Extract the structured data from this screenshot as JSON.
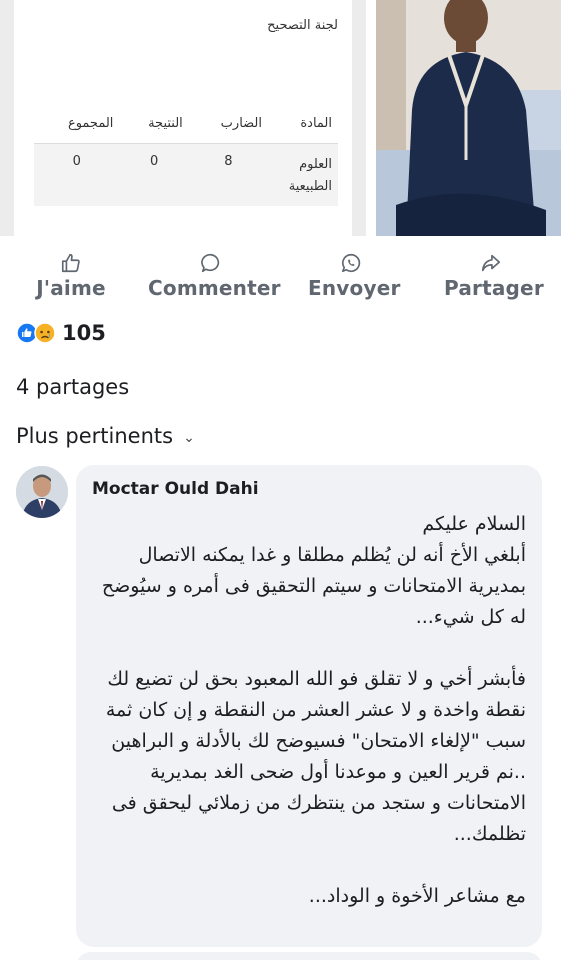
{
  "post_media": {
    "result_card": {
      "committee_label": "لجنة التصحيح",
      "headers": [
        "المادة",
        "الضارب",
        "النتيجة",
        "المجموع"
      ],
      "row": [
        "العلوم\nالطبيعية",
        "8",
        "0",
        "0"
      ]
    }
  },
  "actions": [
    {
      "label": "J'aime",
      "icon": "thumbs-up-icon"
    },
    {
      "label": "Commenter",
      "icon": "comment-icon"
    },
    {
      "label": "Envoyer",
      "icon": "whatsapp-icon"
    },
    {
      "label": "Partager",
      "icon": "share-icon"
    }
  ],
  "reactions": {
    "count": "105",
    "icons": [
      "like-icon",
      "sad-icon"
    ],
    "colors": {
      "like": "#1877f2",
      "sad": "#f7b125"
    }
  },
  "shares_label": "4 partages",
  "sort_label": "Plus pertinents",
  "comment": {
    "author": "Moctar Ould Dahi",
    "text": "السلام عليكم\nأبلغي الأخ  أنه لن يُظلم  مطلقا و غدا يمكنه الاتصال بمديرية الامتحانات و سيتم التحقيق فى أمره و سيُوضح له كل شيء...\n\nفأبشر أخي و لا تقلق فو الله المعبود بحق لن تضيع لك نقطة واخدة و لا عشر العشر من النقطة و إن كان ثمة سبب \"لإلغاء الامتحان\" فسيوضح لك بالأدلة و البراهين ..نم قرير العين و موعدنا أول ضحى الغد بمديرية الامتحانات و ستجد من ينتظرك  من زملائي  ليحقق فى تظلمك...\n\nمع مشاعر الأخوة و الوداد..."
  }
}
